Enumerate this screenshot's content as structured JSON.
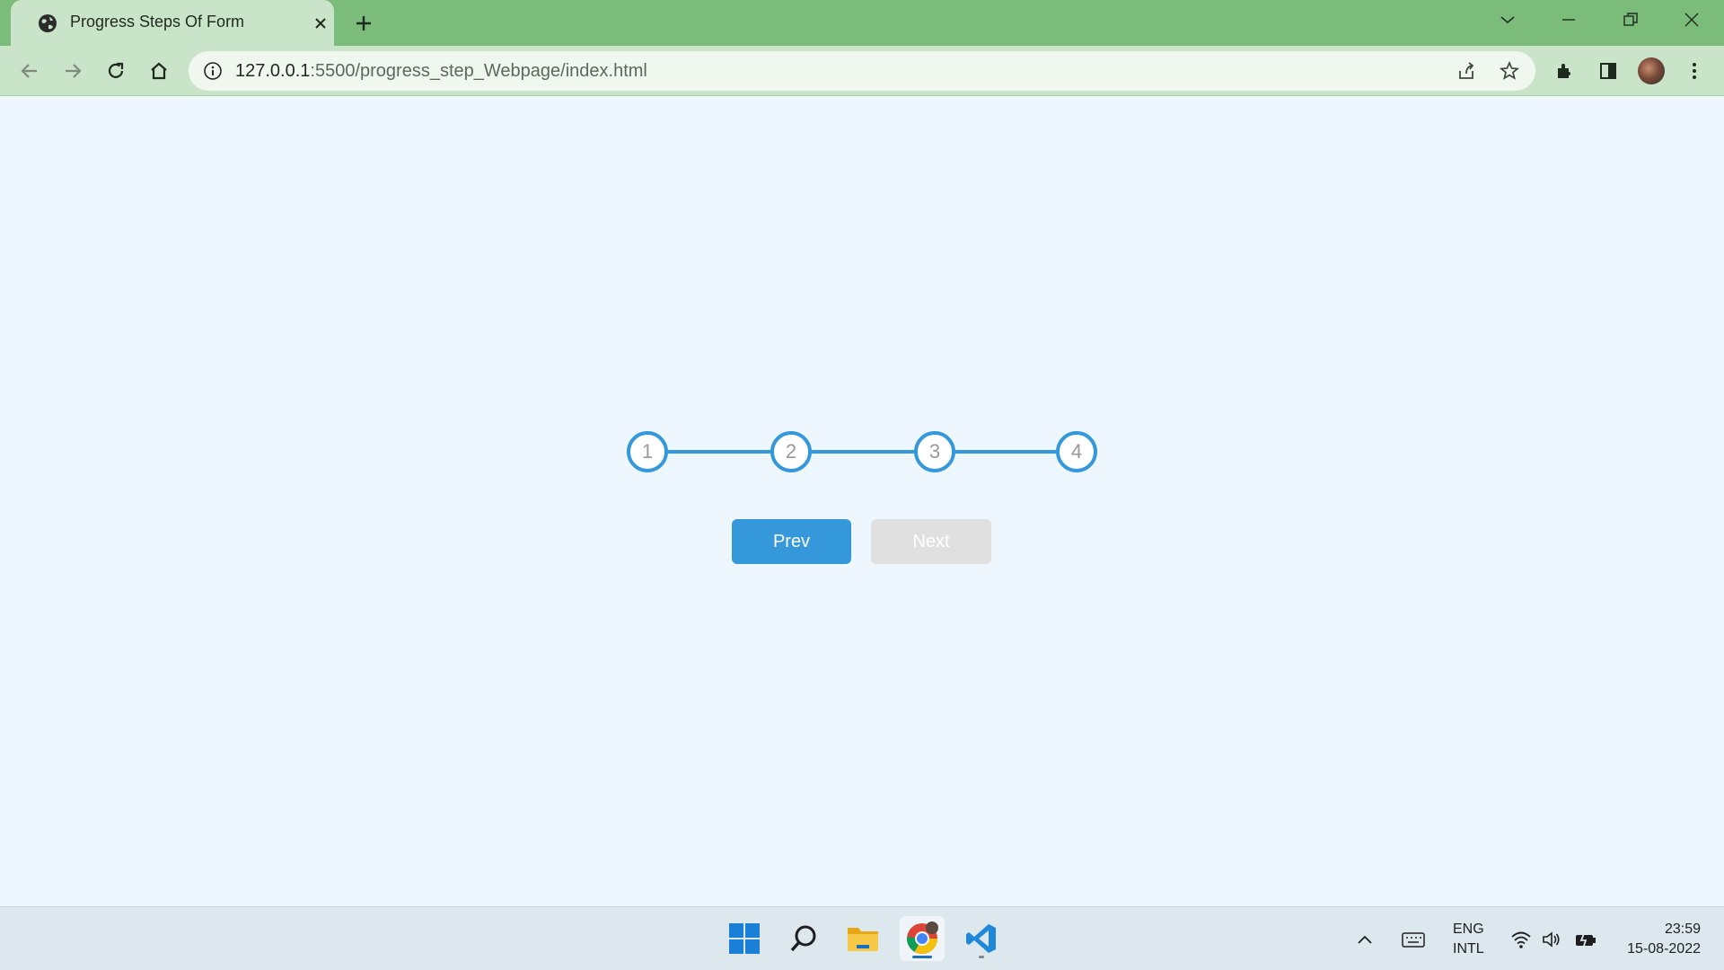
{
  "browser": {
    "tab_title": "Progress Steps Of Form",
    "url_host": "127.0.0.1",
    "url_path": ":5500/progress_step_Webpage/index.html"
  },
  "page": {
    "steps": [
      "1",
      "2",
      "3",
      "4"
    ],
    "prev_label": "Prev",
    "next_label": "Next",
    "colors": {
      "accent": "#3498db",
      "background": "#eff7fe",
      "disabled": "#e0e0e0"
    }
  },
  "taskbar": {
    "lang_line1": "ENG",
    "lang_line2": "INTL",
    "time": "23:59",
    "date": "15-08-2022"
  }
}
